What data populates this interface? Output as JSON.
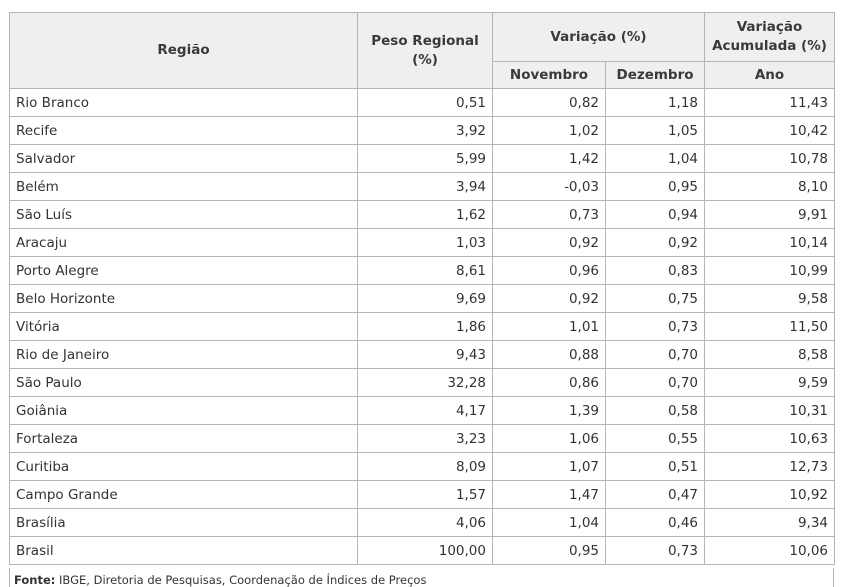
{
  "headers": {
    "regiao": "Região",
    "peso": "Peso Regional (%)",
    "variacao": "Variação (%)",
    "variacao_acumulada": "Variação Acumulada (%)",
    "novembro": "Novembro",
    "dezembro": "Dezembro",
    "ano": "Ano"
  },
  "rows": [
    {
      "regiao": "Rio Branco",
      "peso": "0,51",
      "novembro": "0,82",
      "dezembro": "1,18",
      "ano": "11,43"
    },
    {
      "regiao": "Recife",
      "peso": "3,92",
      "novembro": "1,02",
      "dezembro": "1,05",
      "ano": "10,42"
    },
    {
      "regiao": "Salvador",
      "peso": "5,99",
      "novembro": "1,42",
      "dezembro": "1,04",
      "ano": "10,78"
    },
    {
      "regiao": "Belém",
      "peso": "3,94",
      "novembro": "-0,03",
      "dezembro": "0,95",
      "ano": "8,10"
    },
    {
      "regiao": "São Luís",
      "peso": "1,62",
      "novembro": "0,73",
      "dezembro": "0,94",
      "ano": "9,91"
    },
    {
      "regiao": "Aracaju",
      "peso": "1,03",
      "novembro": "0,92",
      "dezembro": "0,92",
      "ano": "10,14"
    },
    {
      "regiao": "Porto Alegre",
      "peso": "8,61",
      "novembro": "0,96",
      "dezembro": "0,83",
      "ano": "10,99"
    },
    {
      "regiao": "Belo Horizonte",
      "peso": "9,69",
      "novembro": "0,92",
      "dezembro": "0,75",
      "ano": "9,58"
    },
    {
      "regiao": "Vitória",
      "peso": "1,86",
      "novembro": "1,01",
      "dezembro": "0,73",
      "ano": "11,50"
    },
    {
      "regiao": "Rio de Janeiro",
      "peso": "9,43",
      "novembro": "0,88",
      "dezembro": "0,70",
      "ano": "8,58"
    },
    {
      "regiao": "São Paulo",
      "peso": "32,28",
      "novembro": "0,86",
      "dezembro": "0,70",
      "ano": "9,59"
    },
    {
      "regiao": "Goiânia",
      "peso": "4,17",
      "novembro": "1,39",
      "dezembro": "0,58",
      "ano": "10,31"
    },
    {
      "regiao": "Fortaleza",
      "peso": "3,23",
      "novembro": "1,06",
      "dezembro": "0,55",
      "ano": "10,63"
    },
    {
      "regiao": "Curitiba",
      "peso": "8,09",
      "novembro": "1,07",
      "dezembro": "0,51",
      "ano": "12,73"
    },
    {
      "regiao": "Campo Grande",
      "peso": "1,57",
      "novembro": "1,47",
      "dezembro": "0,47",
      "ano": "10,92"
    },
    {
      "regiao": "Brasília",
      "peso": "4,06",
      "novembro": "1,04",
      "dezembro": "0,46",
      "ano": "9,34"
    },
    {
      "regiao": "Brasil",
      "peso": "100,00",
      "novembro": "0,95",
      "dezembro": "0,73",
      "ano": "10,06"
    }
  ],
  "source": {
    "label": "Fonte:",
    "text": " IBGE, Diretoria de Pesquisas, Coordenação de Índices de Preços"
  }
}
